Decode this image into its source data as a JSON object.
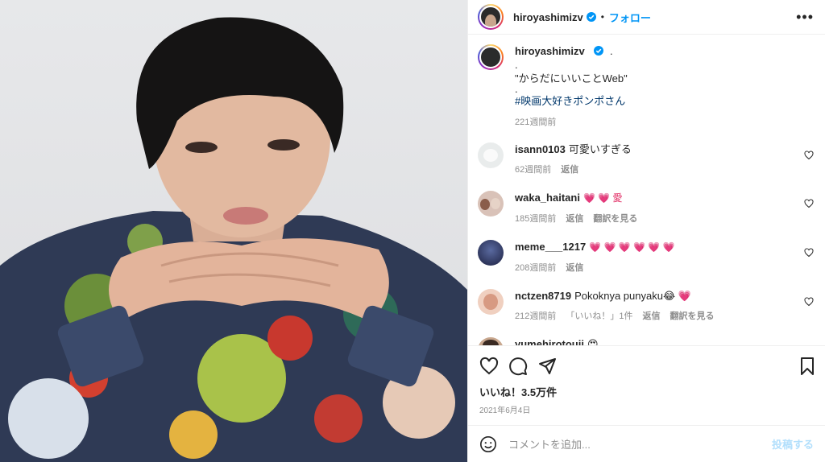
{
  "post": {
    "username": "hiroyashimizv",
    "follow_label": "フォロー",
    "dot": "•",
    "more_label": "•••"
  },
  "caption": {
    "username": "hiroyashimizv",
    "lines": [
      ".",
      ".",
      "\"からだにいいことWeb\"",
      "."
    ],
    "hashtag": "#映画大好きポンポさん",
    "time": "221週間前"
  },
  "comments": [
    {
      "username": "isann0103",
      "text": "可愛いすぎる",
      "time": "62週間前",
      "actions": [
        "返信"
      ]
    },
    {
      "username": "waka_haitani",
      "text": "💗 💗 愛",
      "time": "185週間前",
      "actions": [
        "返信",
        "翻訳を見る"
      ]
    },
    {
      "username": "meme___1217",
      "text": "💗 💗 💗 💗 💗 💗",
      "time": "208週間前",
      "actions": [
        "返信"
      ]
    },
    {
      "username": "nctzen8719",
      "text": "Pokoknya punyaku😂 💗",
      "time": "212週間前",
      "actions": [
        "「いいね！」1件",
        "返信",
        "翻訳を見る"
      ]
    },
    {
      "username": "yumehirotouji",
      "text": "😍",
      "time": "",
      "actions": []
    }
  ],
  "likes": "いいね！3.5万件",
  "date": "2021年6月4日",
  "add_comment": {
    "placeholder": "コメントを追加...",
    "post_label": "投稿する"
  },
  "colors": {
    "accent": "#0095f6",
    "text": "#262626",
    "muted": "#8e8e8e",
    "heart": "#e0245e"
  }
}
